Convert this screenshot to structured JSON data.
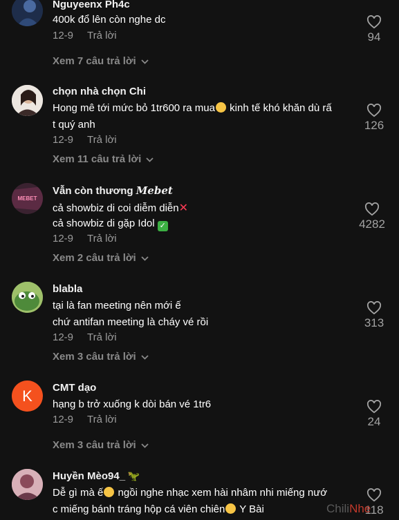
{
  "comments": [
    {
      "username": "Nguyeenx Ph4c",
      "lines": [
        "400k đổ lên còn nghe dc"
      ],
      "date": "12-9",
      "reply_label": "Trả lời",
      "view_replies": "Xem 7 câu trả lời",
      "likes": "94"
    },
    {
      "username": "chọn nhà chọn Chi",
      "lines": [
        "Hong mê tới mức bỏ 1tr600 ra mua",
        " kinh tế khó khăn dù rấ",
        "t quý anh"
      ],
      "date": "12-9",
      "reply_label": "Trả lời",
      "view_replies": "Xem 11 câu trả lời",
      "likes": "126"
    },
    {
      "username": "Vẫn còn thương ",
      "username_fancy": "Mebet",
      "lines": [
        "cả showbiz di coi diễm diễn",
        "cả showbiz di gặp Idol "
      ],
      "date": "12-9",
      "reply_label": "Trả lời",
      "view_replies": "Xem 2 câu trả lời",
      "likes": "4282",
      "avatar_text": "MEBET"
    },
    {
      "username": "blabla",
      "lines": [
        "tại là fan meeting nên mới ế",
        "chứ antifan meeting là cháy vé rồi"
      ],
      "date": "12-9",
      "reply_label": "Trả lời",
      "view_replies": "Xem 3 câu trả lời",
      "likes": "313"
    },
    {
      "username": "CMT dạo",
      "avatar_letter": "K",
      "lines": [
        "hạng b trở xuống k dòi bán vé 1tr6"
      ],
      "date": "12-9",
      "reply_label": "Trả lời",
      "view_replies": "Xem 3 câu trả lời",
      "likes": "24"
    },
    {
      "username": "Huyền Mèo94_",
      "lines": [
        "Dễ gì mà ế",
        " ngồi nghe nhạc xem hài nhâm nhi miếng nướ",
        "c miếng bánh tráng hộp cá viên chiên",
        " Y Bài"
      ],
      "likes": "118"
    }
  ],
  "watermark": {
    "part1": "Chili",
    "part2": "Nhe"
  },
  "colors": {
    "background": "#121212",
    "text": "#ffffff",
    "muted": "#9c9c9c",
    "avatar_k": "#f4511e"
  }
}
